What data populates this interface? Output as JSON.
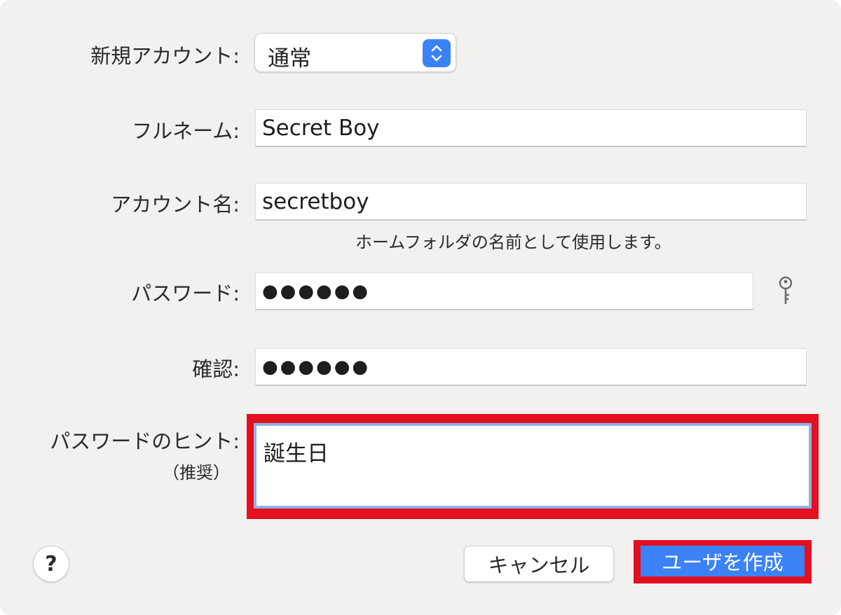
{
  "form": {
    "account_type": {
      "label": "新規アカウント:",
      "value": "通常"
    },
    "full_name": {
      "label": "フルネーム:",
      "value": "Secret Boy"
    },
    "account_name": {
      "label": "アカウント名:",
      "value": "secretboy",
      "note": "ホームフォルダの名前として使用します。"
    },
    "password": {
      "label": "パスワード:",
      "value": "●●●●●●"
    },
    "verify": {
      "label": "確認:",
      "value": "●●●●●●"
    },
    "password_hint": {
      "label": "パスワードのヒント:",
      "sublabel": "（推奨）",
      "value": "誕生日"
    }
  },
  "buttons": {
    "help": "?",
    "cancel": "キャンセル",
    "create": "ユーザを作成"
  },
  "icons": {
    "stepper": "chevron-up-down-icon",
    "password_assistant": "key-icon"
  },
  "colors": {
    "accent": "#3b82f6",
    "highlight_frame": "#e4101f",
    "focus_ring": "#8fb3ea"
  }
}
